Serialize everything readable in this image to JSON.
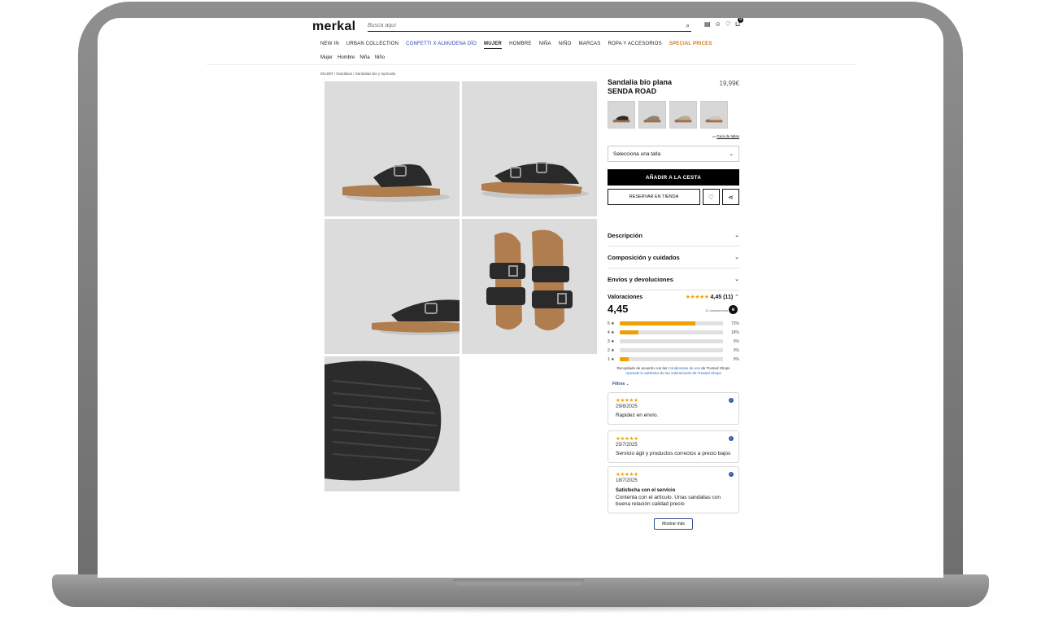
{
  "header": {
    "logo": "merkal",
    "search_placeholder": "Busca aquí",
    "cart_count": "0"
  },
  "nav": {
    "items": [
      "NEW IN",
      "URBAN COLLECTION",
      "CONFETTI X ALMUDENA DÍO",
      "MUJER",
      "HOMBRE",
      "NIÑA",
      "NIÑO",
      "MARCAS",
      "ROPA Y ACCESORIOS",
      "SPECIAL PRICES"
    ],
    "sub_items": [
      "Mujer",
      "Hombre",
      "Niña",
      "Niño"
    ]
  },
  "breadcrumb": "MUJER / Sandalias / Sandalias bio y topmoda",
  "product": {
    "name": "Sandalia bio plana SENDA ROAD",
    "price": "19,99€",
    "size_guide": "Guía de tallas",
    "size_placeholder": "Selecciona una talla",
    "add_to_cart": "AÑADIR A LA CESTA",
    "reserve": "RESERVAR EN TIENDA"
  },
  "accordion": {
    "description": "Descripción",
    "composition": "Composición y cuidados",
    "shipping": "Envíos y devoluciones"
  },
  "ratings": {
    "label": "Valoraciones",
    "summary": "4,45 (11)",
    "score": "4,45",
    "reviewed_by": "11 valoraciones",
    "breakdown": [
      {
        "stars": "5",
        "fraction": 0.73,
        "pct": "73%"
      },
      {
        "stars": "4",
        "fraction": 0.18,
        "pct": "18%"
      },
      {
        "stars": "3",
        "fraction": 0.0,
        "pct": "0%"
      },
      {
        "stars": "2",
        "fraction": 0.0,
        "pct": "0%"
      },
      {
        "stars": "1",
        "fraction": 0.09,
        "pct": "9%"
      }
    ],
    "disclaimer_pre": "Recopilado de acuerdo con las ",
    "disclaimer_link": "Condiciones de uso",
    "disclaimer_post": " de Trusted Shops",
    "authenticity": "Aprende lo auténtico de las valoraciones de Trusted Shops",
    "filters": "Filtros",
    "more": "Mostrar más"
  },
  "reviews": [
    {
      "date": "29/8/2025",
      "title": "",
      "text": "Rapidez en envío."
    },
    {
      "date": "25/7/2025",
      "title": "",
      "text": "Servicio ágil y productos correctos a precio bajos"
    },
    {
      "date": "18/7/2025",
      "title": "Satisfecha con el servicio",
      "text": "Contenta con el artículo. Unas sandalias con buena relación calidad precio"
    }
  ],
  "colors": {
    "accent_star": "#f0a000",
    "link_blue": "#2a66c7",
    "nav_blue": "#2b3bb8",
    "special_orange": "#d07a1a"
  }
}
